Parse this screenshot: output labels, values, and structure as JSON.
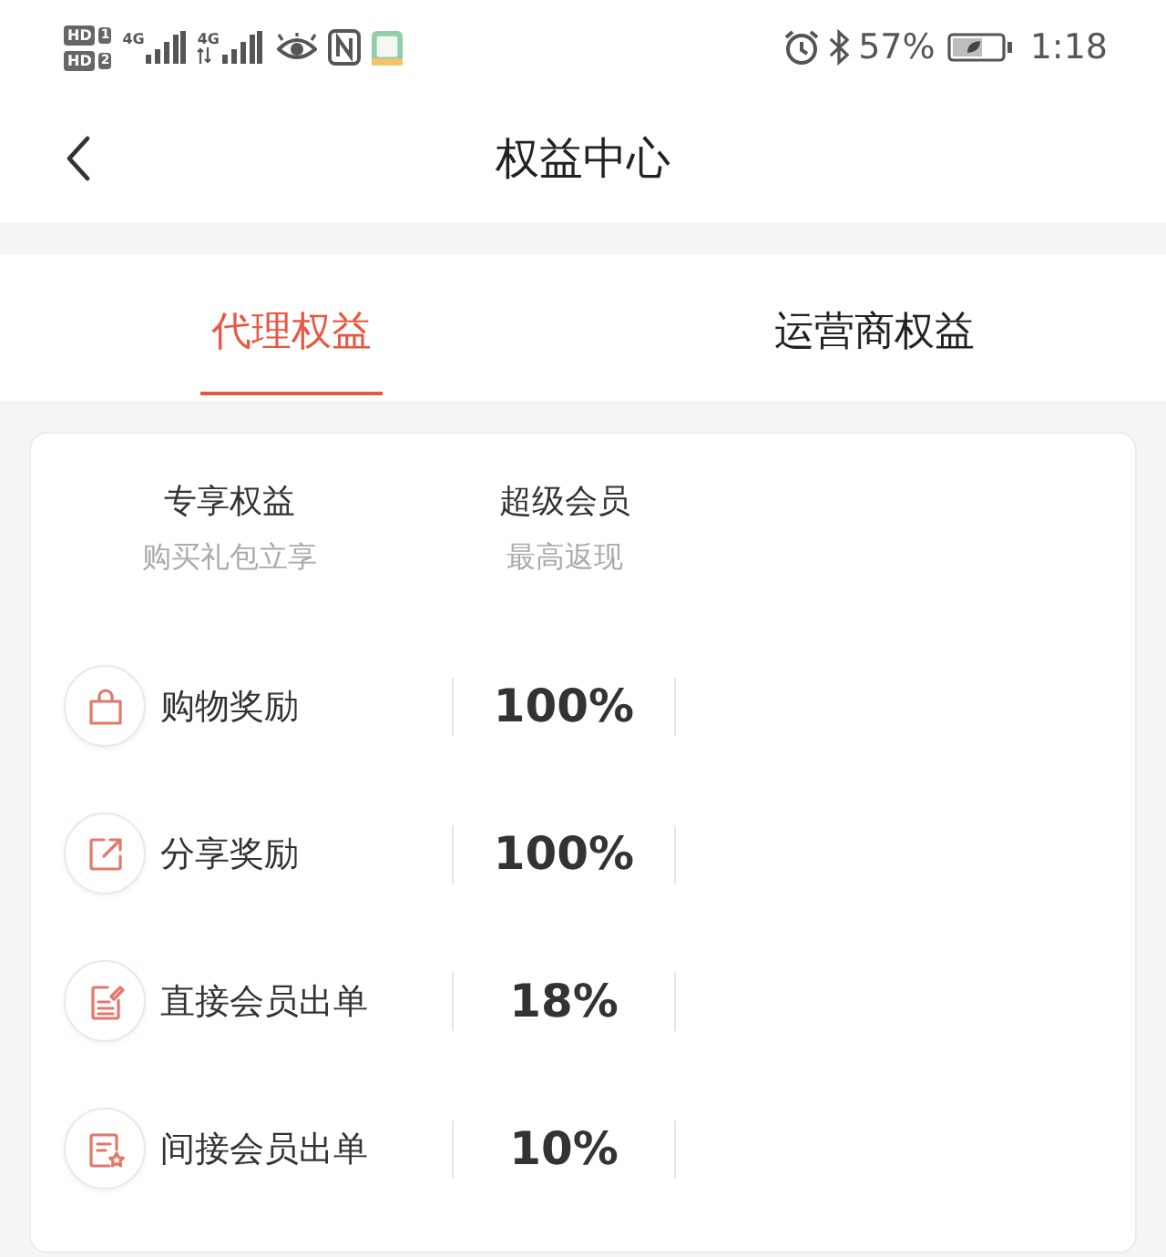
{
  "status_bar": {
    "sims": [
      {
        "badge": "HD",
        "slot": "1"
      },
      {
        "badge": "HD",
        "slot": "2"
      }
    ],
    "networks": [
      {
        "type": "4G",
        "data_active": false
      },
      {
        "type": "4G",
        "data_active": true
      }
    ],
    "battery_percent": "57%",
    "time": "1:18"
  },
  "header": {
    "title": "权益中心"
  },
  "tabs": [
    {
      "label": "代理权益",
      "selected": true
    },
    {
      "label": "运营商权益",
      "selected": false
    }
  ],
  "benefits": {
    "columns": [
      {
        "title": "专享权益",
        "subtitle": "购买礼包立享"
      },
      {
        "title": "超级会员",
        "subtitle": "最高返现"
      }
    ],
    "rows": [
      {
        "kind": "bag",
        "label": "购物奖励",
        "value": "100%"
      },
      {
        "kind": "share",
        "label": "分享奖励",
        "value": "100%"
      },
      {
        "kind": "note",
        "label": "直接会员出单",
        "value": "18%"
      },
      {
        "kind": "list-star",
        "label": "间接会员出单",
        "value": "10%"
      }
    ]
  }
}
